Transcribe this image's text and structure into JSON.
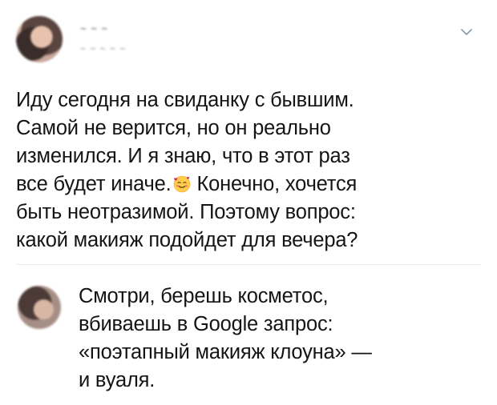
{
  "tweet": {
    "author_name_blurred": "~ ~ ~",
    "author_handle_blurred": "~ ~ ~ ~ ~",
    "menu_icon": "chevron-down-icon",
    "text_lines": [
      "Иду сегодня на свиданку с бывшим.",
      "Самой не верится, но он реально",
      "изменился. И я знаю, что в этот раз",
      "все будет иначе.",
      "Конечно, хочется",
      "быть неотразимой. Поэтому вопрос:",
      "какой макияж подойдет для вечера?"
    ],
    "emoji": "smiling-face-with-hearts-emoji"
  },
  "reply": {
    "text_lines": [
      "Смотри, берешь косметос,",
      "вбиваешь в Google запрос:",
      "«поэтапный макияж клоуна» —",
      "и вуаля."
    ]
  },
  "colors": {
    "text": "#141414",
    "divider": "#e6ecf0",
    "chevron": "#8899a6"
  }
}
